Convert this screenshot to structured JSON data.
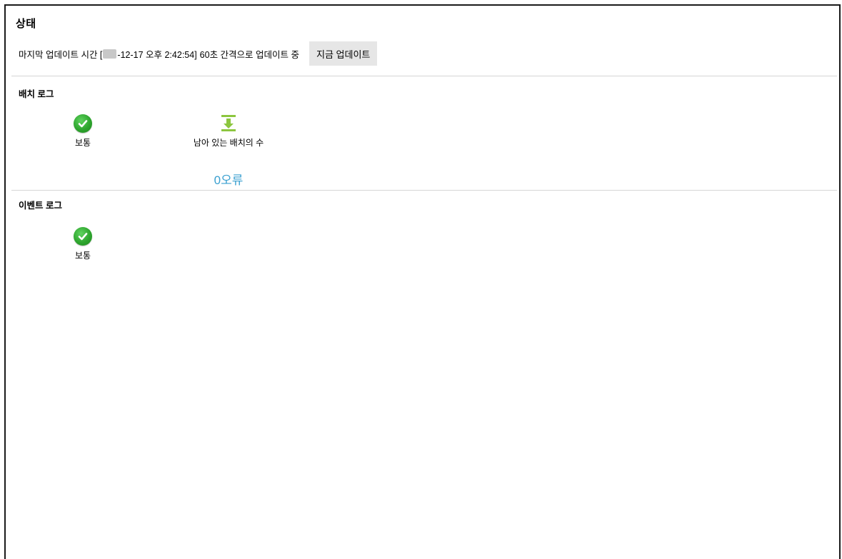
{
  "page": {
    "title": "상태"
  },
  "update": {
    "prefix": "마지막 업데이트 시간 [",
    "timestamp_rest": "-12-17 오후 2:42:54]",
    "interval_text": "60초 간격으로 업데이트 중",
    "button_label": "지금 업데이트"
  },
  "batch_log": {
    "title": "배치 로그",
    "status_icon": "green-check-circle-icon",
    "status_label": "보통",
    "remaining_icon": "download-arrow-icon",
    "remaining_label": "남아 있는 배치의 수",
    "remaining_value": "0오류",
    "remaining_color": "#3aa0d0"
  },
  "event_log": {
    "title": "이벤트 로그",
    "status_icon": "green-check-circle-icon",
    "status_label": "보통"
  }
}
